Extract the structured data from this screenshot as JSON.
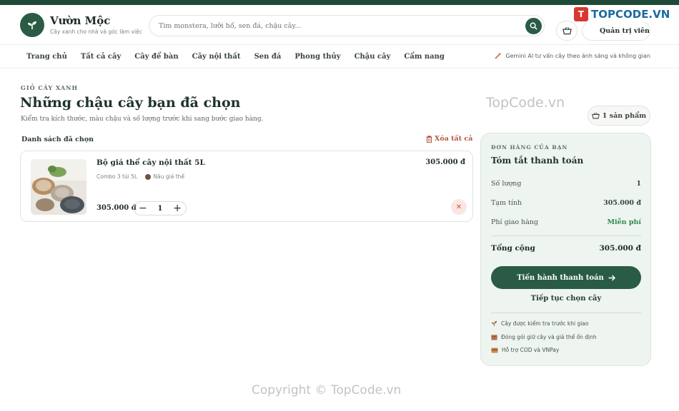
{
  "header": {
    "brand_name": "Vườn Mộc",
    "brand_sub": "Cây xanh cho nhà và góc làm việc",
    "search_placeholder": "Tìm monstera, lưỡi hổ, sen đá, chậu cây...",
    "admin_label": "Quản trị viên"
  },
  "nav": {
    "items": [
      "Trang chủ",
      "Tất cả cây",
      "Cây để bàn",
      "Cây nội thất",
      "Sen đá",
      "Phong thủy",
      "Chậu cây",
      "Cẩm nang"
    ],
    "ai_text": "Gemini AI tư vấn cây theo ánh sáng và không gian"
  },
  "page": {
    "eyebrow": "GIỎ CÂY XANH",
    "title": "Những chậu cây bạn đã chọn",
    "subtitle": "Kiểm tra kích thước, màu chậu và số lượng trước khi sang bước giao hàng.",
    "count_label": "1 sản phẩm",
    "list_head": "Danh sách đã chọn",
    "clear_all": "Xóa tất cả"
  },
  "cart": {
    "items": [
      {
        "name": "Bộ giá thể cây nội thất 5L",
        "variant": "Combo 3 túi 5L",
        "color_name": "Nâu giá thể",
        "price": "305.000 đ",
        "total": "305.000 đ",
        "quantity": "1",
        "remove": "✕"
      }
    ]
  },
  "summary": {
    "eyebrow": "ĐƠN HÀNG CỦA BẠN",
    "title": "Tóm tắt thanh toán",
    "qty_label": "Số lượng",
    "qty_value": "1",
    "subtotal_label": "Tạm tính",
    "subtotal_value": "305.000 đ",
    "shipping_label": "Phí giao hàng",
    "shipping_value": "Miễn phí",
    "total_label": "Tổng cộng",
    "total_value": "305.000 đ",
    "checkout_label": "Tiến hành thanh toán",
    "continue_label": "Tiếp tục chọn cây",
    "notes": [
      "Cây được kiểm tra trước khi giao",
      "Đóng gói giữ cây và giá thể ổn định",
      "Hỗ trợ COD và VNPay"
    ]
  },
  "watermark": {
    "logo_text": "TOPCODE.VN",
    "logo_letter": "T",
    "mid_text": "TopCode.vn",
    "bottom_text": "Copyright © TopCode.vn"
  },
  "colors": {
    "primary": "#2a5c45",
    "danger": "#c45a44",
    "free": "#2f8a4e"
  }
}
